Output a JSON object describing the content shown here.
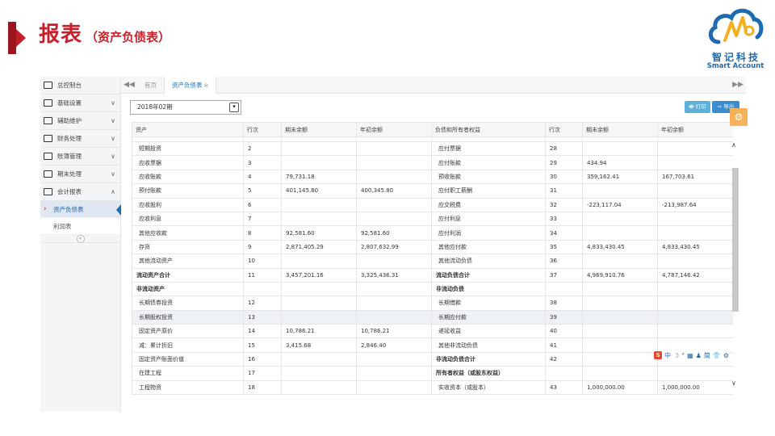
{
  "slide": {
    "title": "报表",
    "subtitle": "（资产负债表）",
    "logo_cn": "智记科技",
    "logo_en": "Smart  Account"
  },
  "sidebar": {
    "items": [
      {
        "label": "总控制台",
        "icon": "monitor-icon"
      },
      {
        "label": "基础设置",
        "icon": "gears-icon",
        "chevron": "∨"
      },
      {
        "label": "辅助维护",
        "icon": "keyboard-icon",
        "chevron": "∨"
      },
      {
        "label": "财务处理",
        "icon": "money-icon",
        "chevron": "∨"
      },
      {
        "label": "账簿管理",
        "icon": "card-icon",
        "chevron": "∨"
      },
      {
        "label": "期末处理",
        "icon": "scale-icon",
        "chevron": "∨"
      },
      {
        "label": "会计报表",
        "icon": "list-icon",
        "chevron": "∧"
      }
    ],
    "subitems": [
      {
        "label": "资产负债表",
        "active": true
      },
      {
        "label": "利润表",
        "active": false
      }
    ],
    "collapse": "«"
  },
  "tabs": {
    "prev": "◀◀",
    "next": "▶▶",
    "items": [
      {
        "label": "首页"
      },
      {
        "label": "资产负债表",
        "close": "⊗"
      }
    ]
  },
  "toolbar": {
    "period": "2018年02期",
    "print_label": "🖶 打印",
    "export_label": "⇨ 导出"
  },
  "table": {
    "headers": [
      "资产",
      "行次",
      "期末余额",
      "年初余额",
      "负债和所有者权益",
      "行次",
      "期末余额",
      "年初余额"
    ],
    "rows": [
      [
        "短期投资",
        "2",
        "",
        "",
        "应付票据",
        "28",
        "",
        ""
      ],
      [
        "应收票据",
        "3",
        "",
        "",
        "应付账款",
        "29",
        "434.94",
        ""
      ],
      [
        "应收账款",
        "4",
        "79,731.18",
        "",
        "预收账款",
        "30",
        "359,162.41",
        "167,703.61"
      ],
      [
        "预付账款",
        "5",
        "401,145.80",
        "400,345.80",
        "应付职工薪酬",
        "31",
        "",
        ""
      ],
      [
        "应收股利",
        "6",
        "",
        "",
        "应交税费",
        "32",
        "-223,117.04",
        "-213,987.64"
      ],
      [
        "应收利息",
        "7",
        "",
        "",
        "应付利息",
        "33",
        "",
        ""
      ],
      [
        "其他应收款",
        "8",
        "92,581.60",
        "92,581.60",
        "应付利润",
        "34",
        "",
        ""
      ],
      [
        "存货",
        "9",
        "2,871,405.29",
        "2,807,632.99",
        "其他应付款",
        "35",
        "4,833,430.45",
        "4,833,430.45"
      ],
      [
        "其他流动资产",
        "10",
        "",
        "",
        "其他流动负债",
        "36",
        "",
        ""
      ],
      [
        "流动资产合计",
        "11",
        "3,457,201.16",
        "3,325,436.31",
        "流动负债合计",
        "37",
        "4,969,910.76",
        "4,787,146.42"
      ],
      [
        "非流动资产",
        "",
        "",
        "",
        "非流动负债",
        "",
        "",
        ""
      ],
      [
        "长期债券投资",
        "12",
        "",
        "",
        "长期借款",
        "38",
        "",
        ""
      ],
      [
        "长期股权投资",
        "13",
        "",
        "",
        "长期应付款",
        "39",
        "",
        ""
      ],
      [
        "固定资产原价",
        "14",
        "10,786.21",
        "10,786.21",
        "递延收益",
        "40",
        "",
        ""
      ],
      [
        "减：累计折旧",
        "15",
        "3,415.68",
        "2,846.40",
        "其他非流动负债",
        "41",
        "",
        ""
      ],
      [
        "固定资产账面价值",
        "16",
        "",
        "",
        "非流动负债合计",
        "42",
        "",
        ""
      ],
      [
        "在建工程",
        "17",
        "",
        "",
        "所有者权益（或股东权益）",
        "",
        "",
        ""
      ],
      [
        "工程物资",
        "18",
        "",
        "",
        "实收资本（或股本）",
        "43",
        "1,000,000.00",
        "1,000,000.00"
      ]
    ]
  },
  "scroll": {
    "up": "∧",
    "down": "∨"
  },
  "float_gear": "⚙",
  "ime_bar": [
    "S",
    "中",
    "☽",
    "°",
    "▦",
    "♟",
    "简",
    "👕",
    "⚙"
  ]
}
